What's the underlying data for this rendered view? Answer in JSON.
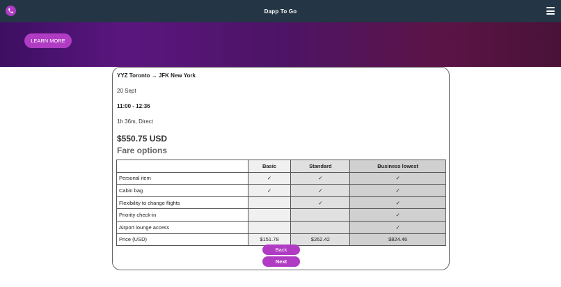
{
  "header": {
    "brand": "Dapp To Go",
    "phone_icon": "phone-icon",
    "menu_icon": "hamburger-menu-icon"
  },
  "hero": {
    "learn_more_label": "LEARN MORE"
  },
  "flight": {
    "route": "YYZ Toronto → JFK New York",
    "date": "20 Sept",
    "time": "11:00 - 12:36",
    "duration": "1h 36m, Direct",
    "price": "$550.75 USD"
  },
  "fares": {
    "title": "Fare options",
    "columns": [
      "",
      "Basic",
      "Standard",
      "Business lowest"
    ],
    "rows": [
      {
        "feature": "Personal item",
        "cells": [
          "✓",
          "✓",
          "✓"
        ]
      },
      {
        "feature": "Cabin bag",
        "cells": [
          "✓",
          "✓",
          "✓"
        ]
      },
      {
        "feature": "Flexibility to change flights",
        "cells": [
          "",
          "✓",
          "✓"
        ]
      },
      {
        "feature": "Priority check-in",
        "cells": [
          "",
          "",
          "✓"
        ]
      },
      {
        "feature": "Airport lounge access",
        "cells": [
          "",
          "",
          "✓"
        ]
      },
      {
        "feature": "Price (USD)",
        "cells": [
          "$151.78",
          "$262.42",
          "$824.46"
        ]
      }
    ]
  },
  "actions": {
    "back_label": "Back",
    "next_label": "Next"
  },
  "colors": {
    "topbar": "#243645",
    "accent": "#b03cc4",
    "hero_start": "#3d0f61",
    "hero_end": "#4a1238"
  }
}
